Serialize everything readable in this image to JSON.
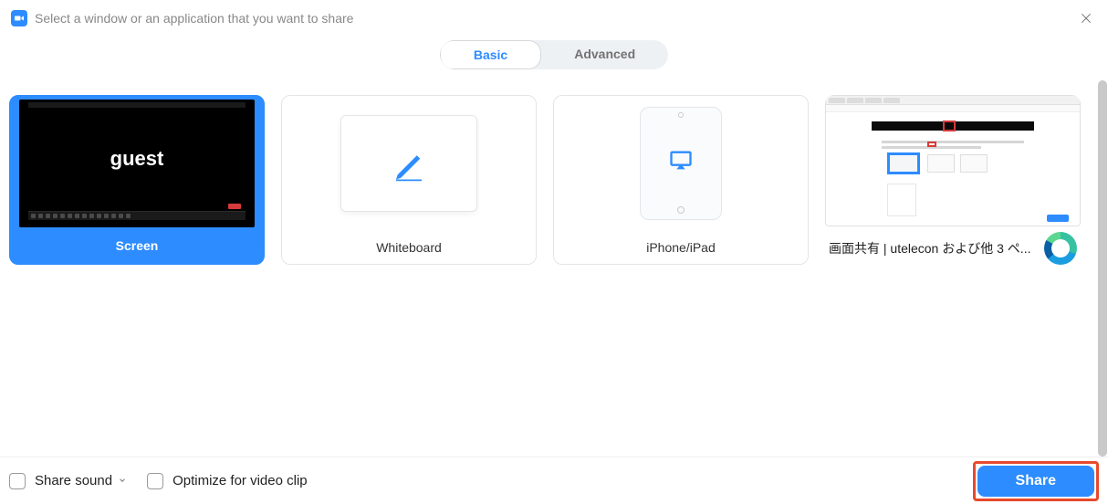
{
  "header": {
    "title": "Select a window or an application that you want to share"
  },
  "tabs": {
    "basic": "Basic",
    "advanced": "Advanced"
  },
  "options": {
    "screen": {
      "label": "Screen",
      "thumb_text": "guest"
    },
    "whiteboard": {
      "label": "Whiteboard"
    },
    "iphone_ipad": {
      "label": "iPhone/iPad"
    },
    "browser_window": {
      "label": "画面共有 | utelecon および他 3 ペ..."
    }
  },
  "footer": {
    "share_sound": "Share sound",
    "optimize": "Optimize for video clip",
    "share": "Share"
  }
}
